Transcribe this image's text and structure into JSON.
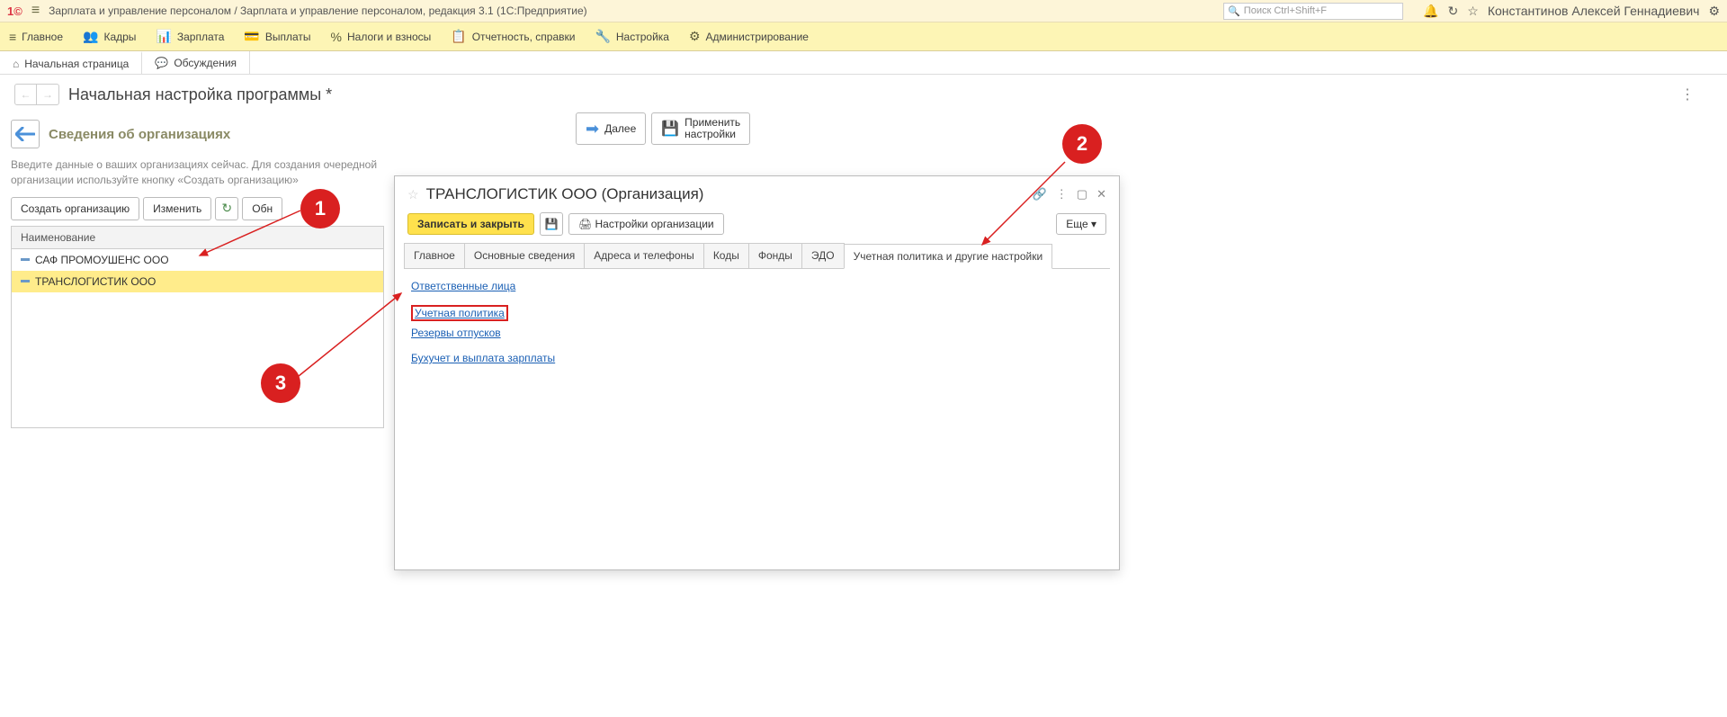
{
  "titlebar": {
    "app_title": "Зарплата и управление персоналом / Зарплата и управление персоналом, редакция 3.1  (1С:Предприятие)",
    "search_placeholder": "Поиск Ctrl+Shift+F",
    "user": "Константинов Алексей Геннадиевич"
  },
  "main_menu": [
    {
      "icon": "≡",
      "label": "Главное"
    },
    {
      "icon": "👥",
      "label": "Кадры"
    },
    {
      "icon": "📊",
      "label": "Зарплата"
    },
    {
      "icon": "💳",
      "label": "Выплаты"
    },
    {
      "icon": "%",
      "label": "Налоги и взносы"
    },
    {
      "icon": "📋",
      "label": "Отчетность, справки"
    },
    {
      "icon": "🔧",
      "label": "Настройка"
    },
    {
      "icon": "⚙",
      "label": "Администрирование"
    }
  ],
  "tabs": [
    {
      "icon": "⌂",
      "label": "Начальная страница"
    },
    {
      "icon": "💬",
      "label": "Обсуждения"
    }
  ],
  "subheader": {
    "title": "Начальная настройка программы *"
  },
  "step": {
    "title": "Сведения об организациях",
    "desc": "Введите данные о ваших организациях сейчас. Для создания очередной организации используйте кнопку «Создать организацию»",
    "btn_create": "Создать организацию",
    "btn_edit": "Изменить",
    "btn_update": "Обн",
    "table_header": "Наименование",
    "rows": [
      "САФ ПРОМОУШЕНС ООО",
      "ТРАНСЛОГИСТИК ООО"
    ]
  },
  "center": {
    "next": "Далее",
    "apply1": "Применить",
    "apply2": "настройки"
  },
  "dialog": {
    "title": "ТРАНСЛОГИСТИК ООО (Организация)",
    "save_close": "Записать и закрыть",
    "settings": "Настройки организации",
    "more": "Еще",
    "tabs": [
      "Главное",
      "Основные сведения",
      "Адреса и телефоны",
      "Коды",
      "Фонды",
      "ЭДО",
      "Учетная политика и другие настройки"
    ],
    "links": [
      "Ответственные лица",
      "Учетная политика",
      "Резервы отпусков",
      "Бухучет и выплата зарплаты"
    ]
  },
  "badges": {
    "b1": "1",
    "b2": "2",
    "b3": "3"
  }
}
